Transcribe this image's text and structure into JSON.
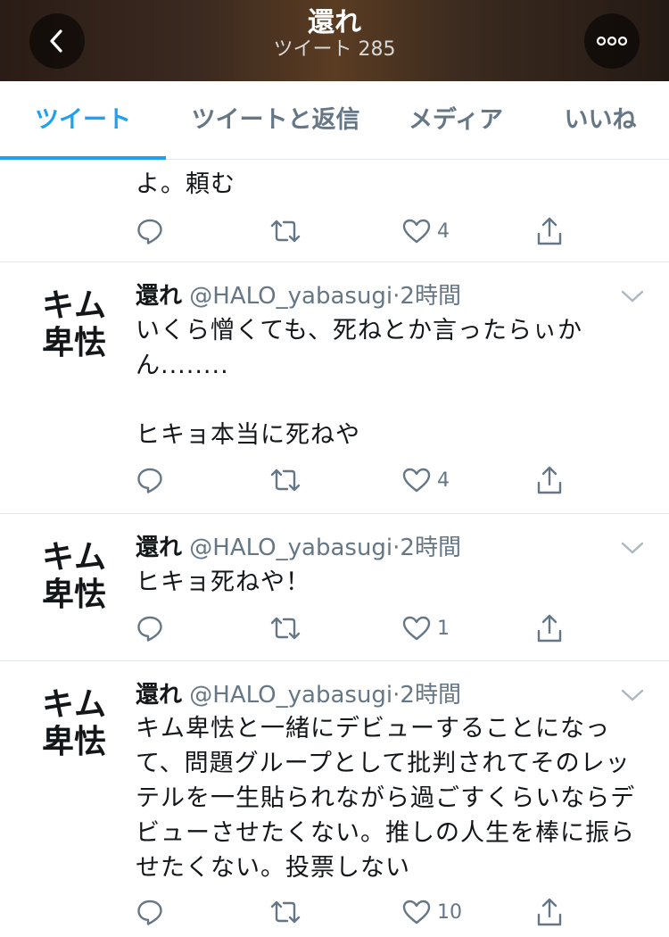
{
  "header": {
    "title": "還れ",
    "subtitle": "ツイート 285"
  },
  "tabs": [
    {
      "label": "ツイート",
      "active": true
    },
    {
      "label": "ツイートと返信",
      "active": false
    },
    {
      "label": "メディア",
      "active": false
    },
    {
      "label": "いいね",
      "active": false
    }
  ],
  "tweets": [
    {
      "text": "よ。頼む",
      "likes": "4"
    },
    {
      "avatar_text": "キム\n卑怯",
      "name": "還れ",
      "handle": "@HALO_yabasugi",
      "sep": "·",
      "time": "2時間",
      "text": "いくら憎くても、死ねとか言ったらぃか\nん........\n\nヒキョ本当に死ねや",
      "likes": "4"
    },
    {
      "avatar_text": "キム\n卑怯",
      "name": "還れ",
      "handle": "@HALO_yabasugi",
      "sep": "·",
      "time": "2時間",
      "text": "ヒキョ死ねや！",
      "likes": "1"
    },
    {
      "avatar_text": "キム\n卑怯",
      "name": "還れ",
      "handle": "@HALO_yabasugi",
      "sep": "·",
      "time": "2時間",
      "text": "キム卑怯と一緒にデビューすることになっ\nて、問題グループとして批判されてそのレッ\nテルを一生貼られながら過ごすくらいならデ\nビューさせたくない。推しの人生を棒に振ら\nせたくない。投票しない",
      "likes": "10"
    }
  ],
  "colors": {
    "accent": "#1da1f2",
    "icon_gray": "#657786",
    "text": "#14171a"
  },
  "icons": {
    "back": "chevron-left-icon",
    "more": "more-horizontal-icon",
    "reply": "reply-icon",
    "retweet": "retweet-icon",
    "like": "heart-icon",
    "share": "share-icon",
    "caret": "chevron-down-icon"
  }
}
